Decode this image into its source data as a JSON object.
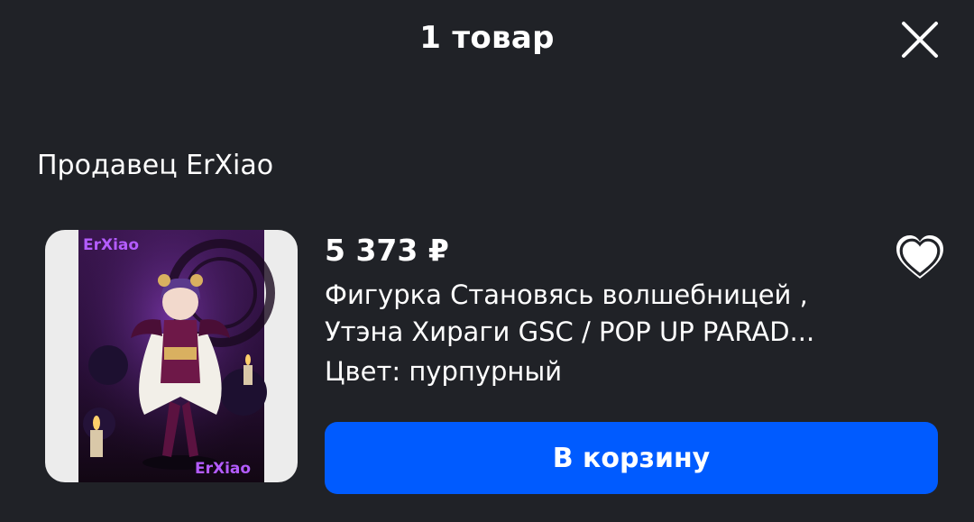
{
  "header": {
    "title": "1 товар",
    "close_icon": "close-icon"
  },
  "seller": {
    "label": "Продавец ErXiao"
  },
  "product": {
    "price": "5 373 ₽",
    "title_line1": "Фигурка Становясь волшебницей ,",
    "title_line2": "Утэна Хираги GSC / POP UP PARAD...",
    "color": "Цвет: пурпурный",
    "image_watermark": "ErXiao",
    "favorite_icon": "heart-outline-icon"
  },
  "actions": {
    "add_to_cart_label": "В корзину"
  },
  "colors": {
    "background": "#202227",
    "accent": "#005bff",
    "text": "#ffffff",
    "thumb_background": "#ececec",
    "watermark": "#b45cff"
  }
}
